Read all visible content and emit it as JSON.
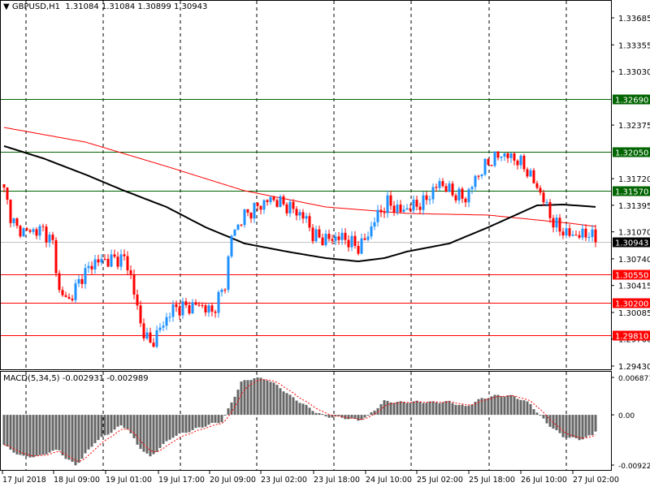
{
  "header": {
    "arrow_icon": "triangle-down",
    "symbol": "GBPUSD,H1",
    "open": "1.31084",
    "high": "1.31084",
    "low": "1.30899",
    "close": "1.30943"
  },
  "macd_header": {
    "label": "MACD(5,34,5)",
    "main": "-0.002931",
    "signal": "-0.002989"
  },
  "colors": {
    "bull": "#1E90FF",
    "bear": "#FF0000",
    "resistance": "#006400",
    "support": "#FF0000",
    "ma_fast": "#000000",
    "ma_slow": "#FF0000",
    "current": "#000000",
    "histogram": "#666666"
  },
  "chart_data": {
    "type": "candlestick",
    "symbol": "GBPUSD",
    "timeframe": "H1",
    "price_ticks": [
      "1.33685",
      "1.33355",
      "1.33030",
      "1.32375",
      "1.31720",
      "1.31395",
      "1.31070",
      "1.30740",
      "1.30415",
      "1.30085",
      "1.29760",
      "1.29430"
    ],
    "ylim": [
      1.2943,
      1.33685
    ],
    "levels": [
      {
        "price": "1.32690",
        "type": "resistance"
      },
      {
        "price": "1.32050",
        "type": "resistance"
      },
      {
        "price": "1.31570",
        "type": "resistance"
      },
      {
        "price": "1.30550",
        "type": "support"
      },
      {
        "price": "1.30200",
        "type": "support"
      },
      {
        "price": "1.29810",
        "type": "support"
      }
    ],
    "current_price": "1.30943",
    "bars": 183,
    "close_keypoints": [
      [
        0,
        1.31572
      ],
      [
        2,
        1.31275
      ],
      [
        4,
        1.31096
      ],
      [
        8,
        1.31076
      ],
      [
        12,
        1.31096
      ],
      [
        15,
        1.30928
      ],
      [
        17,
        1.30333
      ],
      [
        20,
        1.30233
      ],
      [
        24,
        1.30531
      ],
      [
        28,
        1.30709
      ],
      [
        33,
        1.30729
      ],
      [
        37,
        1.30749
      ],
      [
        39,
        1.30531
      ],
      [
        42,
        1.29936
      ],
      [
        45,
        1.29688
      ],
      [
        48,
        1.29886
      ],
      [
        52,
        1.30134
      ],
      [
        57,
        1.30154
      ],
      [
        60,
        1.30184
      ],
      [
        64,
        1.30085
      ],
      [
        68,
        1.30432
      ],
      [
        70,
        1.31027
      ],
      [
        74,
        1.31275
      ],
      [
        78,
        1.31374
      ],
      [
        82,
        1.31473
      ],
      [
        85,
        1.31424
      ],
      [
        89,
        1.31344
      ],
      [
        93,
        1.31225
      ],
      [
        95,
        1.31027
      ],
      [
        99,
        1.30977
      ],
      [
        104,
        1.31007
      ],
      [
        109,
        1.30878
      ],
      [
        112,
        1.31027
      ],
      [
        114,
        1.31225
      ],
      [
        118,
        1.31424
      ],
      [
        122,
        1.31324
      ],
      [
        125,
        1.31374
      ],
      [
        129,
        1.31424
      ],
      [
        134,
        1.31672
      ],
      [
        138,
        1.31543
      ],
      [
        142,
        1.31473
      ],
      [
        145,
        1.31721
      ],
      [
        149,
        1.31919
      ],
      [
        153,
        1.32019
      ],
      [
        157,
        1.31969
      ],
      [
        160,
        1.3187
      ],
      [
        164,
        1.31622
      ],
      [
        167,
        1.31374
      ],
      [
        169,
        1.31176
      ],
      [
        173,
        1.31047
      ],
      [
        177,
        1.31027
      ],
      [
        180,
        1.31057
      ],
      [
        182,
        1.30943
      ]
    ],
    "ma_slow_keypoints": [
      [
        0,
        1.32346
      ],
      [
        25,
        1.32167
      ],
      [
        50,
        1.3187
      ],
      [
        74,
        1.31572
      ],
      [
        99,
        1.31374
      ],
      [
        124,
        1.31295
      ],
      [
        149,
        1.31275
      ],
      [
        174,
        1.31176
      ],
      [
        182,
        1.31136
      ]
    ],
    "ma_fast_keypoints": [
      [
        0,
        1.32118
      ],
      [
        12,
        1.31969
      ],
      [
        25,
        1.31771
      ],
      [
        37,
        1.31572
      ],
      [
        50,
        1.31374
      ],
      [
        62,
        1.31126
      ],
      [
        74,
        1.30928
      ],
      [
        87,
        1.30829
      ],
      [
        99,
        1.30749
      ],
      [
        109,
        1.30709
      ],
      [
        117,
        1.30749
      ],
      [
        124,
        1.30829
      ],
      [
        137,
        1.30928
      ],
      [
        149,
        1.31126
      ],
      [
        159,
        1.31305
      ],
      [
        164,
        1.31394
      ],
      [
        172,
        1.31404
      ],
      [
        182,
        1.31375
      ]
    ],
    "macd_ticks": [
      "0.006871",
      "0.00",
      "-0.009224"
    ],
    "macd_ylim": [
      -0.009224,
      0.006871
    ],
    "macd_keypoints": [
      [
        0,
        -0.0055
      ],
      [
        2,
        -0.0065
      ],
      [
        6,
        -0.0077
      ],
      [
        11,
        -0.0076
      ],
      [
        14,
        -0.0068
      ],
      [
        17,
        -0.0065
      ],
      [
        19,
        -0.008
      ],
      [
        22,
        -0.0092
      ],
      [
        24,
        -0.008
      ],
      [
        28,
        -0.005
      ],
      [
        32,
        -0.0035
      ],
      [
        36,
        -0.002
      ],
      [
        38,
        -0.0025
      ],
      [
        41,
        -0.0055
      ],
      [
        45,
        -0.0078
      ],
      [
        48,
        -0.006
      ],
      [
        52,
        -0.004
      ],
      [
        57,
        -0.003
      ],
      [
        62,
        -0.002
      ],
      [
        67,
        -0.0012
      ],
      [
        69,
        0.001
      ],
      [
        73,
        0.006
      ],
      [
        77,
        0.0068
      ],
      [
        81,
        0.0065
      ],
      [
        85,
        0.005
      ],
      [
        88,
        0.0035
      ],
      [
        92,
        0.002
      ],
      [
        96,
        0.0005
      ],
      [
        99,
        -0.0003
      ],
      [
        104,
        -0.0005
      ],
      [
        109,
        -0.001
      ],
      [
        112,
        -0.0002
      ],
      [
        117,
        0.0025
      ],
      [
        122,
        0.0023
      ],
      [
        127,
        0.0024
      ],
      [
        132,
        0.0023
      ],
      [
        137,
        0.0024
      ],
      [
        142,
        0.0015
      ],
      [
        147,
        0.003
      ],
      [
        152,
        0.0036
      ],
      [
        157,
        0.0034
      ],
      [
        162,
        0.002
      ],
      [
        164,
        0.0005
      ],
      [
        167,
        -0.0015
      ],
      [
        172,
        -0.004
      ],
      [
        177,
        -0.0045
      ],
      [
        181,
        -0.0038
      ],
      [
        182,
        -0.0029
      ]
    ],
    "time_labels": [
      "17 Jul 2018",
      "18 Jul 09:00",
      "19 Jul 01:00",
      "19 Jul 17:00",
      "20 Jul 09:00",
      "23 Jul 02:00",
      "23 Jul 18:00",
      "24 Jul 10:00",
      "25 Jul 02:00",
      "25 Jul 18:00",
      "26 Jul 10:00",
      "27 Jul 02:00"
    ]
  }
}
